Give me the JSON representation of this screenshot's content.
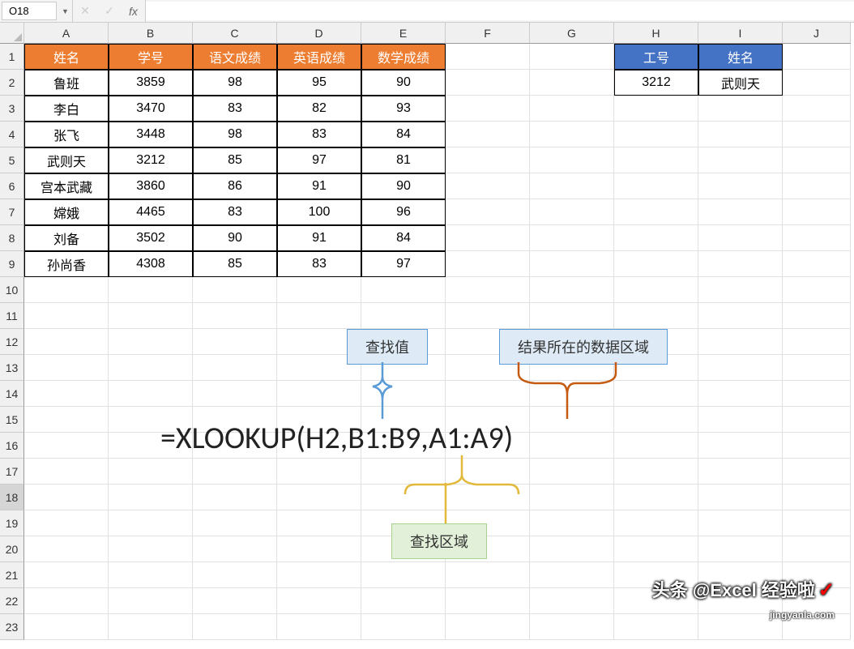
{
  "nameBox": "O18",
  "formula": "",
  "cols": [
    "A",
    "B",
    "C",
    "D",
    "E",
    "F",
    "G",
    "H",
    "I",
    "J"
  ],
  "rows": [
    "1",
    "2",
    "3",
    "4",
    "5",
    "6",
    "7",
    "8",
    "9",
    "10",
    "11",
    "12",
    "13",
    "14",
    "15",
    "16",
    "17",
    "18",
    "19",
    "20",
    "21",
    "22",
    "23"
  ],
  "colWidths": [
    "wA",
    "wB",
    "wC",
    "wD",
    "wE",
    "wF",
    "wG",
    "wH",
    "wI",
    "wJ"
  ],
  "table1": {
    "headers": [
      "姓名",
      "学号",
      "语文成绩",
      "英语成绩",
      "数学成绩"
    ],
    "rows": [
      [
        "鲁班",
        "3859",
        "98",
        "95",
        "90"
      ],
      [
        "李白",
        "3470",
        "83",
        "82",
        "93"
      ],
      [
        "张飞",
        "3448",
        "98",
        "83",
        "84"
      ],
      [
        "武则天",
        "3212",
        "85",
        "97",
        "81"
      ],
      [
        "宫本武藏",
        "3860",
        "86",
        "91",
        "90"
      ],
      [
        "嫦娥",
        "4465",
        "83",
        "100",
        "96"
      ],
      [
        "刘备",
        "3502",
        "90",
        "91",
        "84"
      ],
      [
        "孙尚香",
        "4308",
        "85",
        "83",
        "97"
      ]
    ]
  },
  "table2": {
    "headers": [
      "工号",
      "姓名"
    ],
    "rows": [
      [
        "3212",
        "武则天"
      ]
    ]
  },
  "anno": {
    "lookup_value": "查找值",
    "result_range": "结果所在的数据区域",
    "lookup_range": "查找区域",
    "formula_text": "=XLOOKUP(H2,B1:B9,A1:A9)"
  },
  "watermark": {
    "main": "头条 @Excel 经验啦",
    "sub": "jingyanla.com"
  }
}
